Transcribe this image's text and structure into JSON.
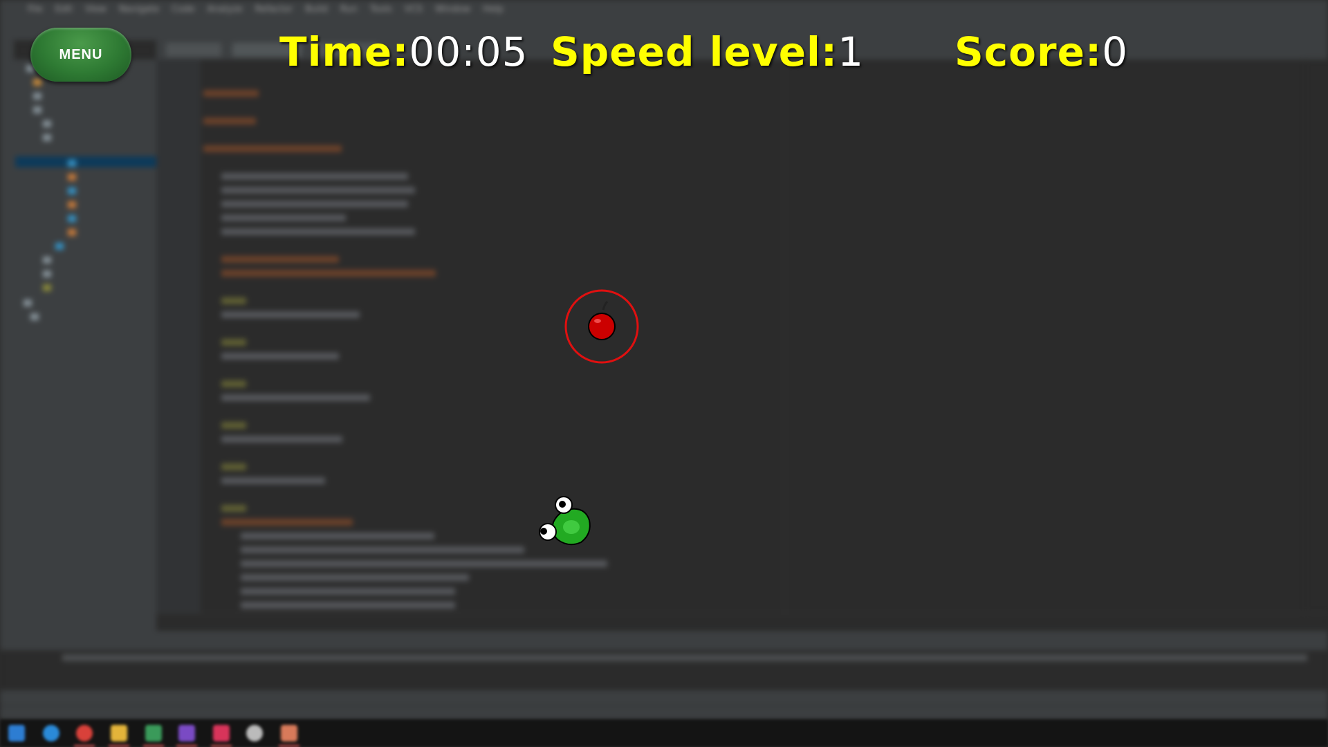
{
  "hud": {
    "menu_label": "MENU",
    "time_label": "Time:",
    "time_value": "00:05",
    "speed_label": "Speed level:",
    "speed_value": "1",
    "score_label": "Score:",
    "score_value": "0"
  },
  "colors": {
    "hud_text": "#ffff00",
    "value_text": "#ffffff",
    "menu_button": "#2e7a33",
    "apple": "#cc0000",
    "apple_ring": "#e01010",
    "snake": "#22aa22"
  },
  "game": {
    "food": {
      "type": "apple",
      "highlighted": true
    },
    "snake": {
      "segments": 1,
      "eyes": 2
    }
  },
  "icons": {
    "menu_button": "rounded-pill-button",
    "food": "apple-icon",
    "snake_head": "snake-head-icon"
  }
}
